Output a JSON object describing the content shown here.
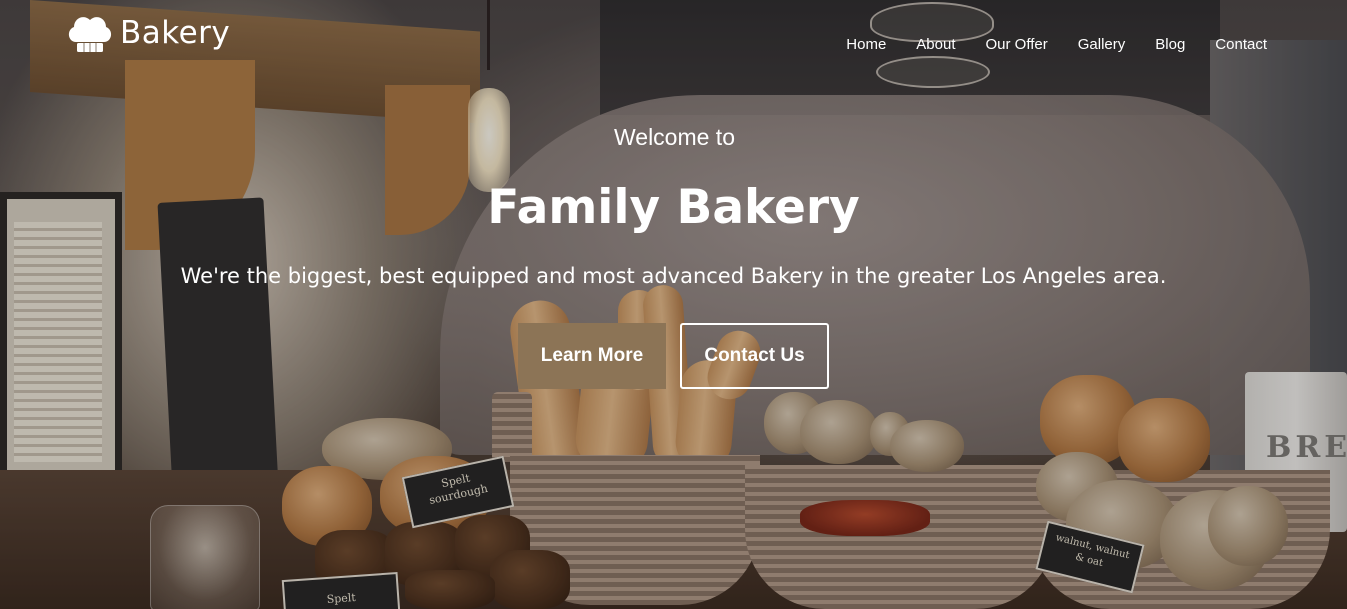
{
  "brand": {
    "name": "Bakery",
    "icon": "chef-hat-icon"
  },
  "nav": {
    "items": [
      {
        "label": "Home"
      },
      {
        "label": "About"
      },
      {
        "label": "Our Offer"
      },
      {
        "label": "Gallery"
      },
      {
        "label": "Blog"
      },
      {
        "label": "Contact"
      }
    ]
  },
  "hero": {
    "welcome": "Welcome to",
    "title": "Family Bakery",
    "subtitle": "We're the biggest, best equipped and most advanced Bakery in the greater Los Angeles area.",
    "primary_button": "Learn More",
    "secondary_button": "Contact Us"
  },
  "background": {
    "sign_1": [
      "Spelt",
      "sourdough"
    ],
    "sign_2": "Spelt",
    "sign_3": [
      "walnut, walnut",
      "& oat"
    ],
    "chalkboard": "LOAF 100 ... ANY 1/2 LOAF £2",
    "tin_label": "BRE"
  },
  "colors": {
    "accent": "#8c7456",
    "text": "#ffffff"
  }
}
